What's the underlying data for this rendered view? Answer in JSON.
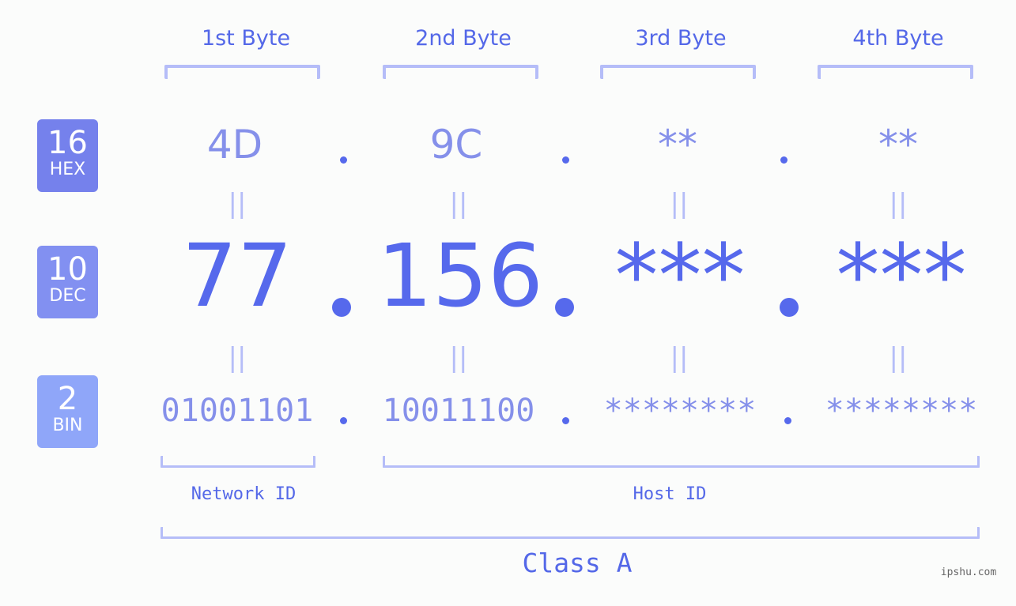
{
  "bytes": [
    {
      "header": "1st Byte",
      "hex": "4D",
      "dec": "77",
      "bin": "01001101"
    },
    {
      "header": "2nd Byte",
      "hex": "9C",
      "dec": "156",
      "bin": "10011100"
    },
    {
      "header": "3rd Byte",
      "hex": "**",
      "dec": "***",
      "bin": "********"
    },
    {
      "header": "4th Byte",
      "hex": "**",
      "dec": "***",
      "bin": "********"
    }
  ],
  "badges": {
    "hex": {
      "num": "16",
      "label": "HEX",
      "color": "#7581ec"
    },
    "dec": {
      "num": "10",
      "label": "DEC",
      "color": "#8290f1"
    },
    "bin": {
      "num": "2",
      "label": "BIN",
      "color": "#8fa6f9"
    }
  },
  "equals_sign": "||",
  "network_id_label": "Network ID",
  "host_id_label": "Host ID",
  "class_label": "Class A",
  "watermark": "ipshu.com"
}
